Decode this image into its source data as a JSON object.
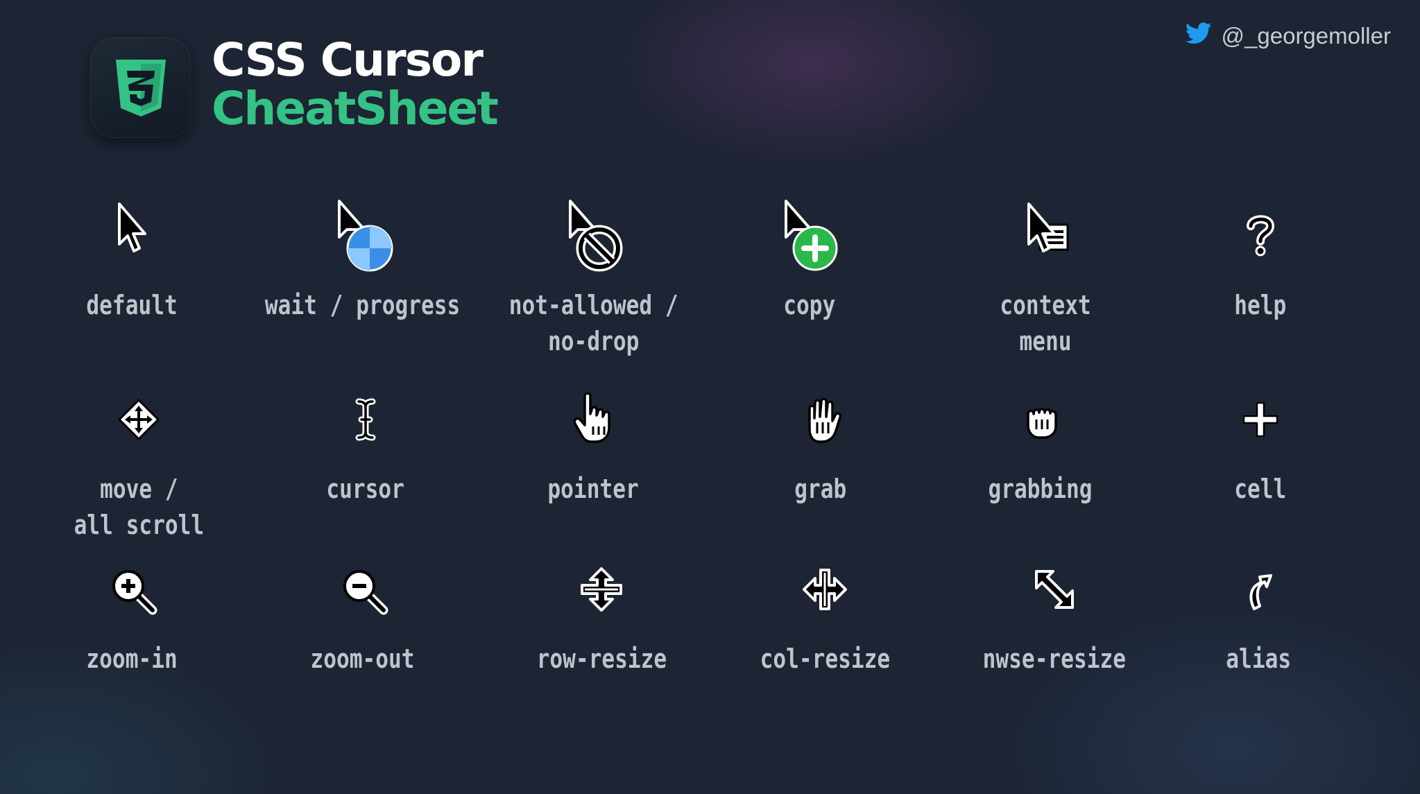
{
  "header": {
    "title_line1": "CSS Cursor",
    "title_line2": "CheatSheet",
    "logo_icon": "css3-logo-icon",
    "twitter_handle": "@_georgemoller",
    "twitter_icon": "twitter-bird-icon"
  },
  "colors": {
    "background": "#1d2433",
    "accent_green": "#34c385",
    "label_gray": "#bfc4cc",
    "twitter_blue": "#1d9bf0"
  },
  "cursors": [
    {
      "icon": "arrow-cursor-icon",
      "lines": [
        "default"
      ]
    },
    {
      "icon": "wait-progress-cursor-icon",
      "lines": [
        "wait / progress"
      ]
    },
    {
      "icon": "not-allowed-cursor-icon",
      "lines": [
        "not-allowed /",
        "no-drop"
      ]
    },
    {
      "icon": "copy-cursor-icon",
      "lines": [
        "copy"
      ]
    },
    {
      "icon": "context-menu-cursor-icon",
      "lines": [
        "context",
        "menu"
      ]
    },
    {
      "icon": "help-cursor-icon",
      "lines": [
        "help"
      ]
    },
    {
      "icon": "move-cursor-icon",
      "lines": [
        "move /",
        "all scroll"
      ]
    },
    {
      "icon": "text-cursor-icon",
      "lines": [
        "cursor"
      ]
    },
    {
      "icon": "pointer-hand-cursor-icon",
      "lines": [
        "pointer"
      ]
    },
    {
      "icon": "grab-hand-cursor-icon",
      "lines": [
        "grab"
      ]
    },
    {
      "icon": "grabbing-hand-cursor-icon",
      "lines": [
        "grabbing"
      ]
    },
    {
      "icon": "cell-cursor-icon",
      "lines": [
        "cell"
      ]
    },
    {
      "icon": "zoom-in-cursor-icon",
      "lines": [
        "zoom-in"
      ]
    },
    {
      "icon": "zoom-out-cursor-icon",
      "lines": [
        "zoom-out"
      ]
    },
    {
      "icon": "row-resize-cursor-icon",
      "lines": [
        "row-resize"
      ]
    },
    {
      "icon": "col-resize-cursor-icon",
      "lines": [
        "col-resize"
      ]
    },
    {
      "icon": "nwse-resize-cursor-icon",
      "lines": [
        "nwse-resize"
      ]
    },
    {
      "icon": "alias-cursor-icon",
      "lines": [
        "alias"
      ]
    }
  ]
}
